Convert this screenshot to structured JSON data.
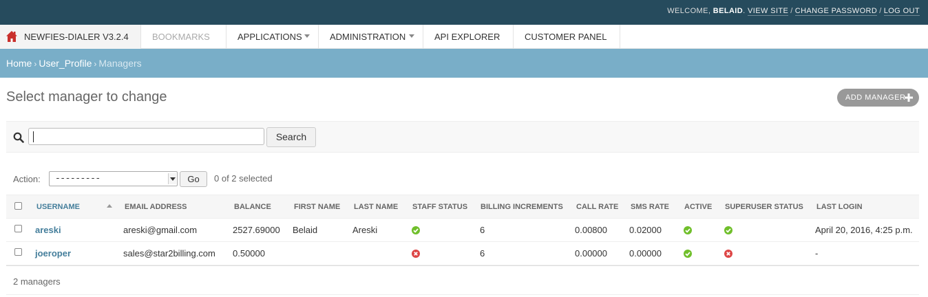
{
  "header": {
    "welcome_text": "WELCOME,",
    "username": "BELAID",
    "view_site": "VIEW SITE",
    "change_password": "CHANGE PASSWORD",
    "logout": "LOG OUT",
    "separator": "/"
  },
  "nav": {
    "brand": "NEWFIES-DIALER V3.2.4",
    "items": [
      {
        "label": "BOOKMARKS",
        "dropdown": false
      },
      {
        "label": "APPLICATIONS",
        "dropdown": true
      },
      {
        "label": "ADMINISTRATION",
        "dropdown": true
      },
      {
        "label": "API EXPLORER",
        "dropdown": false
      },
      {
        "label": "CUSTOMER PANEL",
        "dropdown": false
      }
    ]
  },
  "breadcrumbs": {
    "items": [
      "Home",
      "User_Profile",
      "Managers"
    ],
    "separator": "›"
  },
  "page": {
    "title": "Select manager to change",
    "add_button": "ADD MANAGER"
  },
  "search": {
    "value": "",
    "button": "Search"
  },
  "actions": {
    "label": "Action:",
    "selected_option": "---------",
    "go_button": "Go",
    "selection_count": "0 of 2 selected"
  },
  "table": {
    "columns": [
      "USERNAME",
      "EMAIL ADDRESS",
      "BALANCE",
      "FIRST NAME",
      "LAST NAME",
      "STAFF STATUS",
      "BILLING INCREMENTS",
      "CALL RATE",
      "SMS RATE",
      "ACTIVE",
      "SUPERUSER STATUS",
      "LAST LOGIN"
    ],
    "sorted_column": "USERNAME",
    "rows": [
      {
        "username": "areski",
        "email": "areski@gmail.com",
        "balance": "2527.69000",
        "first_name": "Belaid",
        "last_name": "Areski",
        "staff_status": "yes",
        "billing_increments": "6",
        "call_rate": "0.00800",
        "sms_rate": "0.02000",
        "active": "yes",
        "superuser_status": "yes",
        "last_login": "April 20, 2016, 4:25 p.m."
      },
      {
        "username": "joeroper",
        "email": "sales@star2billing.com",
        "balance": "0.50000",
        "first_name": "",
        "last_name": "",
        "staff_status": "no",
        "billing_increments": "6",
        "call_rate": "0.00000",
        "sms_rate": "0.00000",
        "active": "yes",
        "superuser_status": "no",
        "last_login": "-"
      }
    ]
  },
  "paginator": {
    "text": "2 managers"
  },
  "colors": {
    "header_bg": "#264b5d",
    "breadcrumb_bg": "#79aec8",
    "link": "#447e9b",
    "yes_icon": "#70bf2b",
    "no_icon": "#dd4646"
  }
}
